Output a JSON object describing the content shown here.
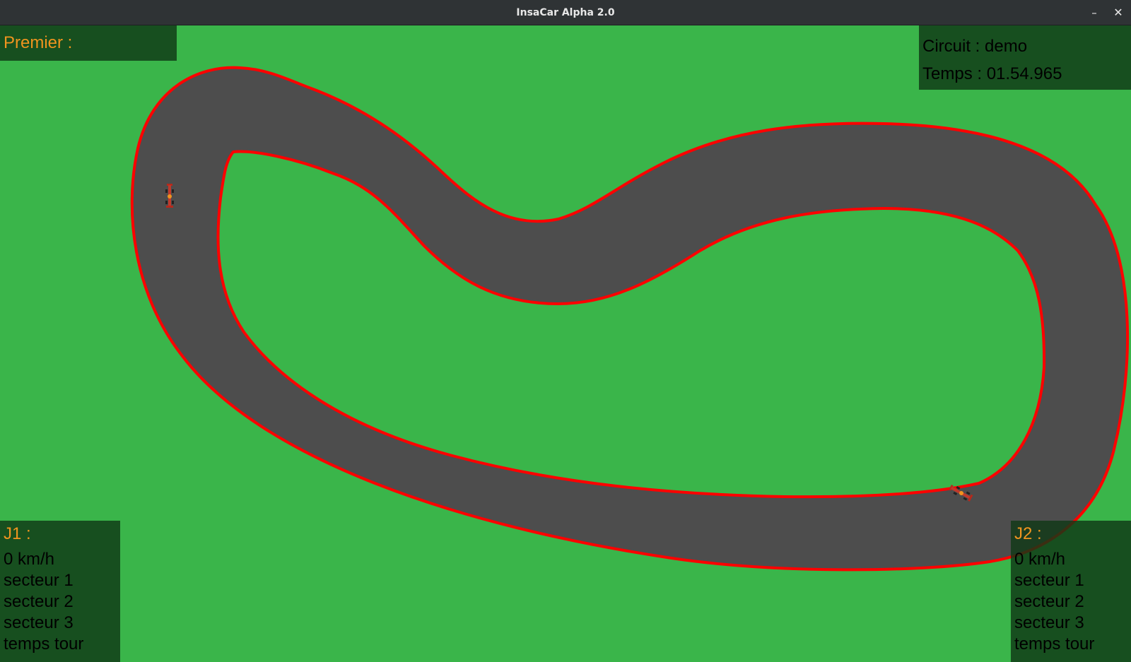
{
  "window": {
    "title": "InsaCar Alpha 2.0",
    "minimize_label": "–",
    "close_label": "✕"
  },
  "hud": {
    "leader_label": "Premier :",
    "circuit_label": "Circuit : demo",
    "time_label": "Temps : 01.54.965"
  },
  "players": [
    {
      "name": "J1 :",
      "speed": "0 km/h",
      "sector1": "secteur 1",
      "sector2": "secteur 2",
      "sector3": "secteur 3",
      "lap_time": "temps tour"
    },
    {
      "name": "J2 :",
      "speed": "0 km/h",
      "sector1": "secteur 1",
      "sector2": "secteur 2",
      "sector3": "secteur 3",
      "lap_time": "temps tour"
    }
  ],
  "colors": {
    "grass": "#3ab54a",
    "asphalt": "#4d4d4d",
    "track_border": "#ff0000",
    "hud_panel": "#103816",
    "hud_accent": "#f0941f"
  },
  "icons": {
    "car_player_1": "race-car-icon",
    "car_player_2": "race-car-icon"
  }
}
